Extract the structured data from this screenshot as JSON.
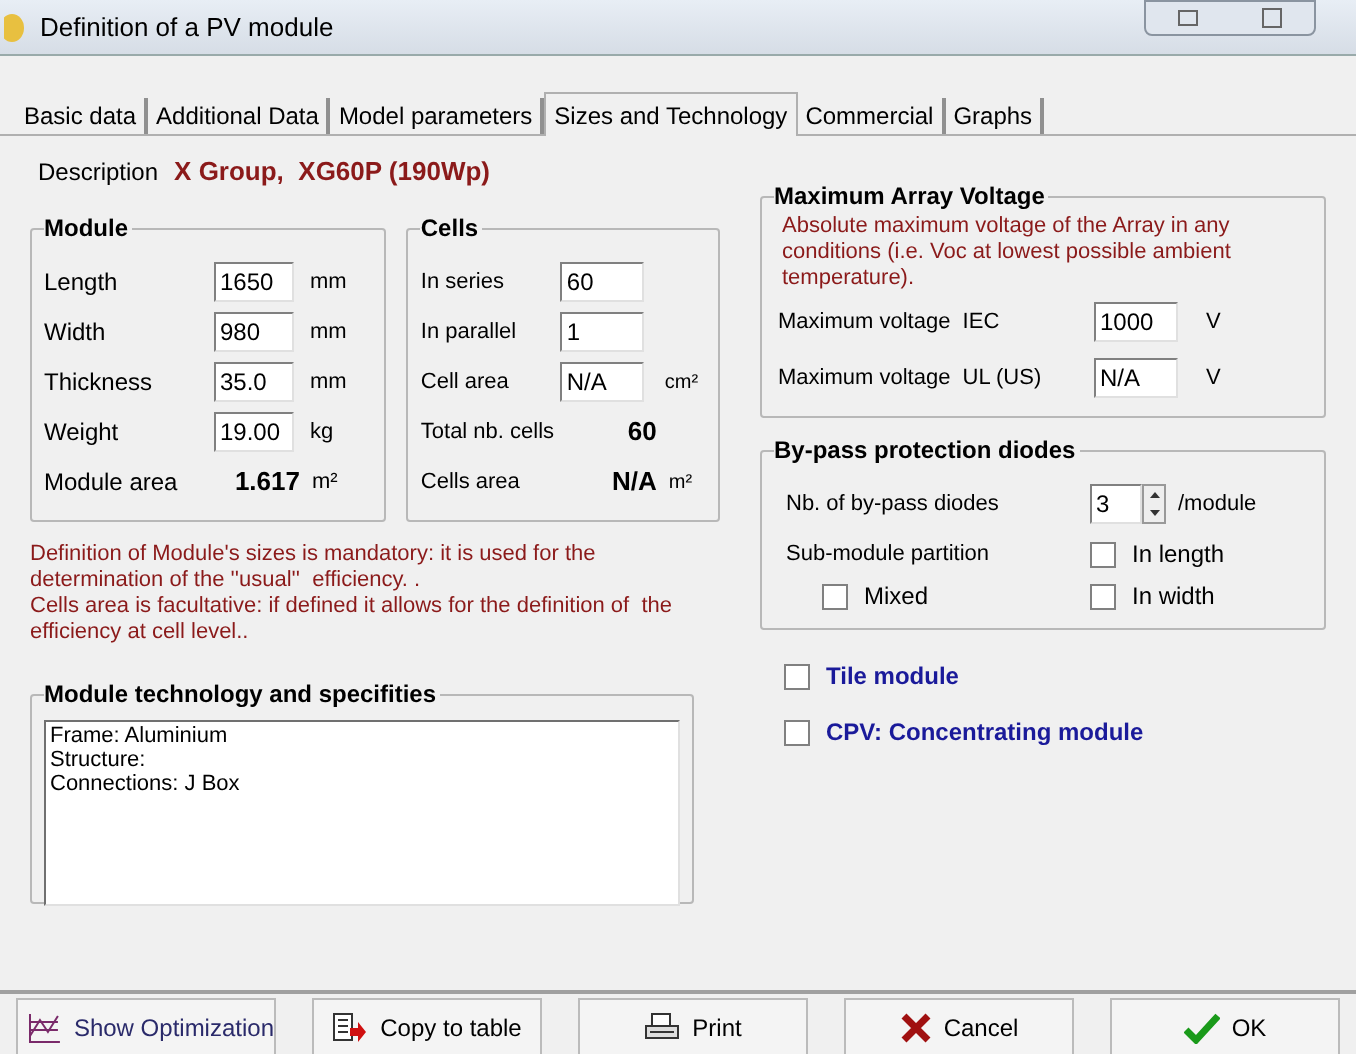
{
  "window": {
    "title": "Definition of a PV module"
  },
  "tabs": [
    {
      "label": "Basic data",
      "selected": false
    },
    {
      "label": "Additional Data",
      "selected": false
    },
    {
      "label": "Model parameters",
      "selected": false
    },
    {
      "label": "Sizes and Technology",
      "selected": true
    },
    {
      "label": "Commercial",
      "selected": false
    },
    {
      "label": "Graphs",
      "selected": false
    }
  ],
  "description": {
    "label": "Description",
    "value": "X Group,  XG60P (190Wp)"
  },
  "module": {
    "title": "Module",
    "fields": [
      {
        "label": "Length",
        "value": "1650",
        "unit": "mm"
      },
      {
        "label": "Width",
        "value": "980",
        "unit": "mm"
      },
      {
        "label": "Thickness",
        "value": "35.0",
        "unit": "mm"
      },
      {
        "label": "Weight",
        "value": "19.00",
        "unit": "kg"
      }
    ],
    "result": {
      "label": "Module area",
      "value": "1.617",
      "unit": "m²"
    }
  },
  "cells": {
    "title": "Cells",
    "fields": [
      {
        "label": "In series",
        "value": "60"
      },
      {
        "label": "In parallel",
        "value": "1"
      },
      {
        "label": "Cell area",
        "value": "N/A",
        "unit": "cm²"
      }
    ],
    "results": [
      {
        "label": "Total nb. cells",
        "value": "60"
      },
      {
        "label": "Cells area",
        "value": "N/A",
        "unit": "m²"
      }
    ]
  },
  "note": [
    "Definition of Module's sizes is mandatory: it is used for the determination of the ''usual''  efficiency. .",
    "Cells area is facultative: if defined it allows for the definition of  the efficiency at cell level.."
  ],
  "technology": {
    "title": "Module technology and specifities",
    "lines": [
      "Frame: Aluminium",
      "Structure:",
      "Connections: J Box"
    ]
  },
  "max_voltage": {
    "title": "Maximum Array Voltage",
    "note": "Absolute maximum voltage of the Array in any conditions (i.e. Voc at lowest possible ambient temperature).",
    "fields": [
      {
        "label": "Maximum voltage  IEC",
        "value": "1000",
        "unit": "V"
      },
      {
        "label": "Maximum voltage  UL (US)",
        "value": "N/A",
        "unit": "V"
      }
    ]
  },
  "bypass": {
    "title": "By-pass protection diodes",
    "count_label": "Nb. of by-pass diodes",
    "count": "3",
    "count_unit": "/module",
    "partition_label": "Sub-module partition",
    "options": [
      {
        "label": "In length",
        "checked": false
      },
      {
        "label": "Mixed",
        "checked": false
      },
      {
        "label": "In width",
        "checked": false
      }
    ]
  },
  "flags": [
    {
      "label": "Tile module",
      "checked": false
    },
    {
      "label": "CPV: Concentrating module",
      "checked": false
    }
  ],
  "buttons": [
    {
      "kind": "optimization",
      "label": "Show Optimization"
    },
    {
      "kind": "copy",
      "label": "Copy to table"
    },
    {
      "kind": "print",
      "label": "Print"
    },
    {
      "kind": "cancel",
      "label": "Cancel"
    },
    {
      "kind": "ok",
      "label": "OK"
    }
  ]
}
